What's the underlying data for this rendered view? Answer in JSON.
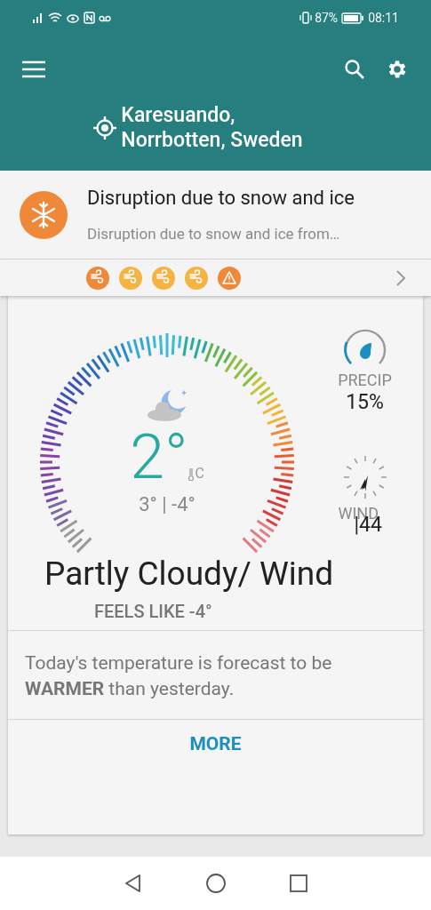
{
  "status_bar": {
    "battery": "87%",
    "time": "08:11"
  },
  "location": {
    "line1": "Karesuando,",
    "line2": "Norrbotten, Sweden"
  },
  "alert": {
    "title": "Disruption due to snow and ice",
    "summary": "Disruption due to snow and ice from…"
  },
  "warning_icons": [
    {
      "kind": "wind",
      "color": "#f0883a"
    },
    {
      "kind": "wind",
      "color": "#f5b342"
    },
    {
      "kind": "wind",
      "color": "#f5b342"
    },
    {
      "kind": "wind",
      "color": "#f5b342"
    },
    {
      "kind": "warning",
      "color": "#f0883a"
    }
  ],
  "current": {
    "temperature": "2°",
    "unit": "C",
    "high_low": "3° | -4°",
    "condition": "Partly Cloudy/ Wind",
    "feels_like": "FEELS LIKE -4°"
  },
  "precip": {
    "label": "PRECIP",
    "value": "15%"
  },
  "wind": {
    "label": "WIND",
    "value": "|44"
  },
  "comparison": {
    "text": "Today's temperature is forecast to be **WARMER** than yesterday."
  },
  "more_button": "MORE"
}
